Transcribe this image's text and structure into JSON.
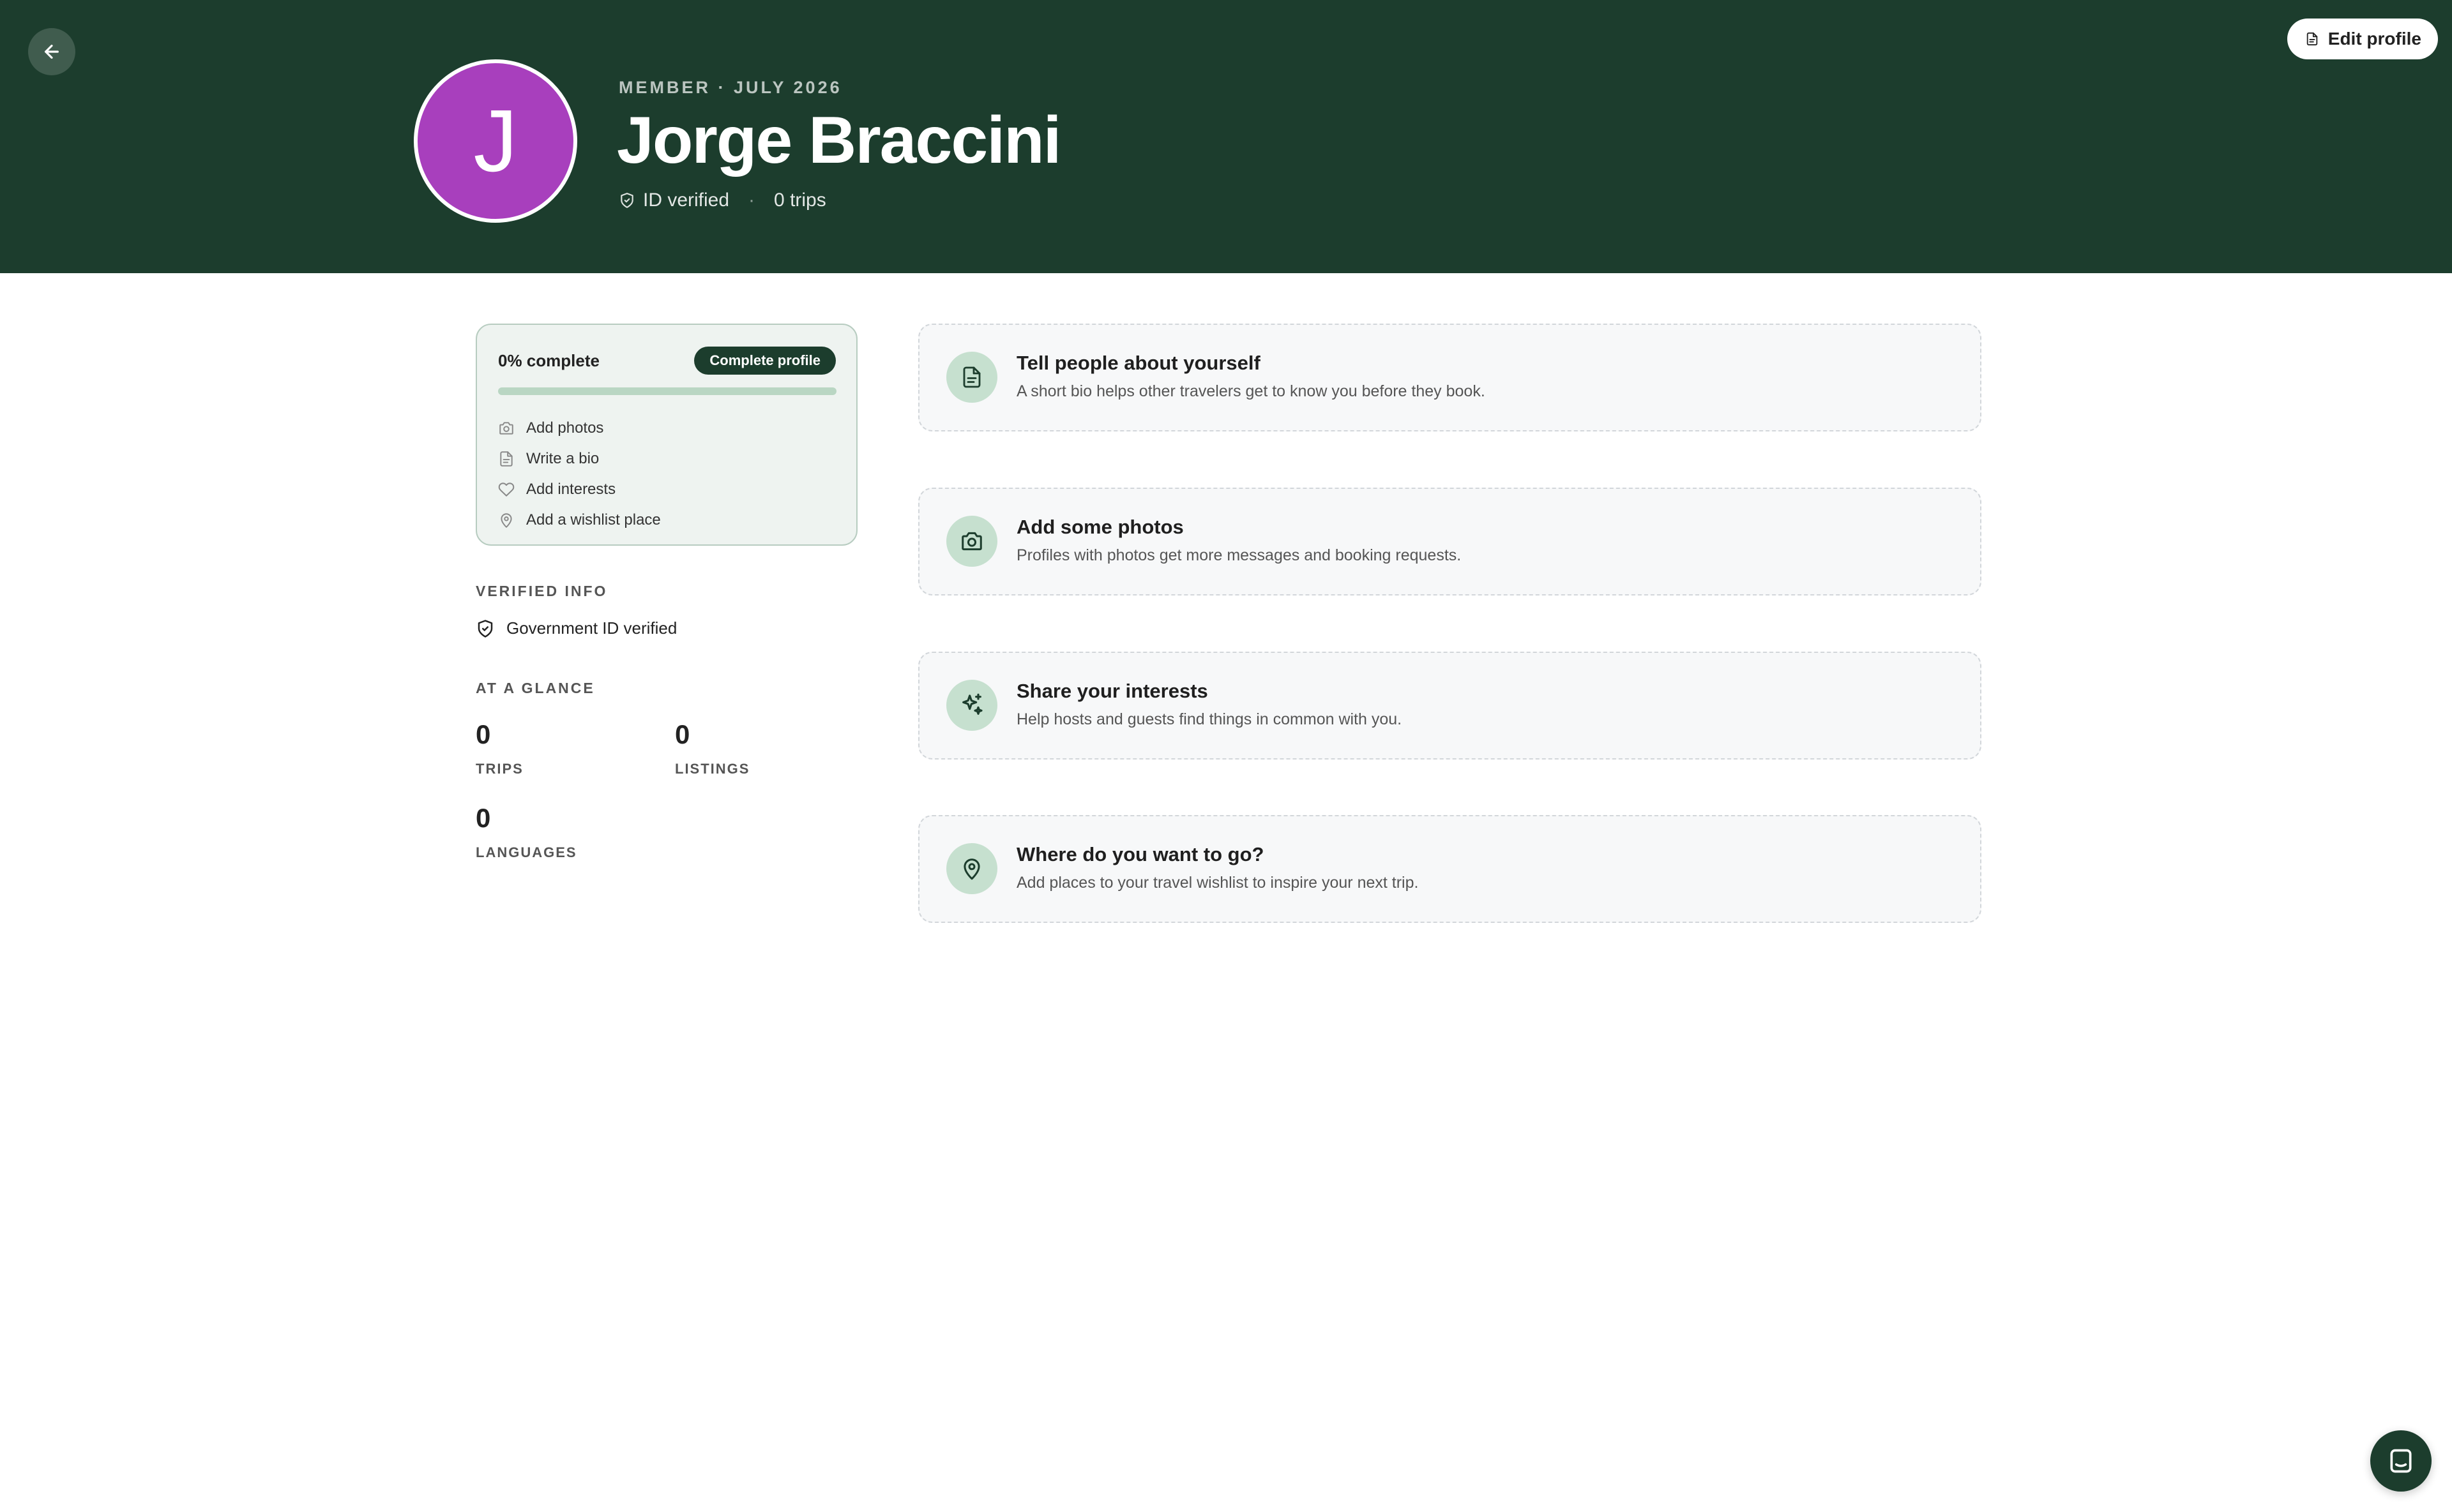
{
  "header": {
    "member_since": "MEMBER · JULY 2026",
    "name": "Jorge Braccini",
    "avatar_initial": "J",
    "avatar_color": "#a83fbd",
    "id_verified": "ID verified",
    "separator": "·",
    "trips": "0 trips",
    "edit_profile_label": "Edit profile",
    "back_icon": "arrow-left-icon",
    "background_color": "#1c3d2d"
  },
  "progress": {
    "percent_label": "0% complete",
    "percent_value": 0,
    "complete_button_label": "Complete profile",
    "items": [
      {
        "label": "Add photos",
        "icon": "camera-icon"
      },
      {
        "label": "Write a bio",
        "icon": "document-icon"
      },
      {
        "label": "Add interests",
        "icon": "heart-icon"
      },
      {
        "label": "Add a wishlist place",
        "icon": "location-pin-icon"
      }
    ]
  },
  "verified": {
    "heading": "VERIFIED INFO",
    "items": [
      {
        "label": "Government ID verified",
        "icon": "shield-check-icon"
      }
    ]
  },
  "glance": {
    "heading": "AT A GLANCE",
    "stats": [
      {
        "value": "0",
        "label": "TRIPS"
      },
      {
        "value": "0",
        "label": "LISTINGS"
      },
      {
        "value": "0",
        "label": "LANGUAGES"
      }
    ]
  },
  "prompts": [
    {
      "title": "Tell people about yourself",
      "subtitle": "A short bio helps other travelers get to know you before they book.",
      "icon": "document-icon"
    },
    {
      "title": "Add some photos",
      "subtitle": "Profiles with photos get more messages and booking requests.",
      "icon": "camera-icon"
    },
    {
      "title": "Share your interests",
      "subtitle": "Help hosts and guests find things in common with you.",
      "icon": "sparkles-icon"
    },
    {
      "title": "Where do you want to go?",
      "subtitle": "Add places to your travel wishlist to inspire your next trip.",
      "icon": "location-pin-icon"
    }
  ],
  "chat": {
    "icon": "chat-icon"
  }
}
